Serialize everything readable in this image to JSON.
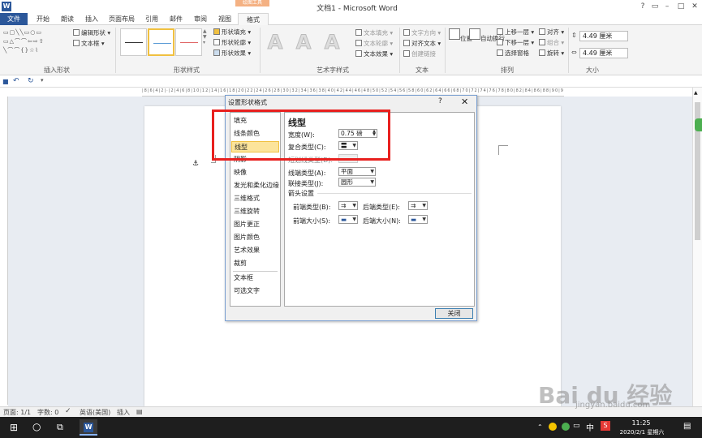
{
  "window": {
    "app_logo": "W",
    "title": "文档1 - Microsoft Word",
    "contextual_tab_group": "绘图工具"
  },
  "tabs": [
    "文件",
    "开始",
    "朗读",
    "插入",
    "页面布局",
    "引用",
    "邮件",
    "审阅",
    "视图",
    "格式"
  ],
  "ribbon": {
    "groups": [
      "插入形状",
      "形状样式",
      "艺术字样式",
      "文本",
      "排列",
      "大小"
    ],
    "insert_shapes": {
      "edit_shape": "编辑形状 ▾",
      "text_box": "文本框 ▾"
    },
    "shape_styles": {
      "fill": "形状填充 ▾",
      "outline": "形状轮廓 ▾",
      "effects": "形状效果 ▾"
    },
    "wordart": {
      "fill": "文本填充 ▾",
      "outline": "文本轮廓 ▾",
      "effects": "文本效果 ▾",
      "letters": [
        "A",
        "A",
        "A"
      ]
    },
    "text": {
      "direction": "文字方向 ▾",
      "align": "对齐文本 ▾",
      "link": "创建链接"
    },
    "arrange": {
      "position": "位置",
      "wrap": "自动换行",
      "bring_forward": "上移一层 ▾",
      "send_backward": "下移一层 ▾",
      "selection_pane": "选择窗格",
      "align": "对齐 ▾",
      "group": "组合 ▾",
      "rotate": "旋转 ▾"
    },
    "size": {
      "height": "4.49 厘米",
      "width": "4.49 厘米"
    }
  },
  "dialog": {
    "title": "设置形状格式",
    "help": "?",
    "close_x": "✕",
    "categories": [
      "填充",
      "线条颜色",
      "线型",
      "阴影",
      "映像",
      "发光和柔化边缘",
      "三维格式",
      "三维旋转",
      "图片更正",
      "图片颜色",
      "艺术效果",
      "裁剪",
      "文本框",
      "可选文字"
    ],
    "selected_category": "线型",
    "panel": {
      "title": "线型",
      "width_label": "宽度(W):",
      "width_value": "0.75 磅",
      "compound_label": "复合类型(C):",
      "dash_label": "短划线类型(D):",
      "cap_label": "线端类型(A):",
      "cap_value": "平面",
      "join_label": "联接类型(J):",
      "join_value": "圆形",
      "arrow_section": "箭头设置",
      "begin_type": "前端类型(B):",
      "end_type": "后端类型(E):",
      "begin_size": "前端大小(S):",
      "end_size": "后端大小(N):"
    },
    "close_button": "关闭"
  },
  "statusbar": {
    "page": "页面: 1/1",
    "words": "字数: 0",
    "lang": "英语(美国)",
    "mode": "插入"
  },
  "taskbar": {
    "time": "11:25",
    "date": "2020/2/1 星期六",
    "ime": "中",
    "ime2": "S"
  },
  "watermark": {
    "logo": "Bai du 经验",
    "url": "jingyan.baidu.com"
  }
}
